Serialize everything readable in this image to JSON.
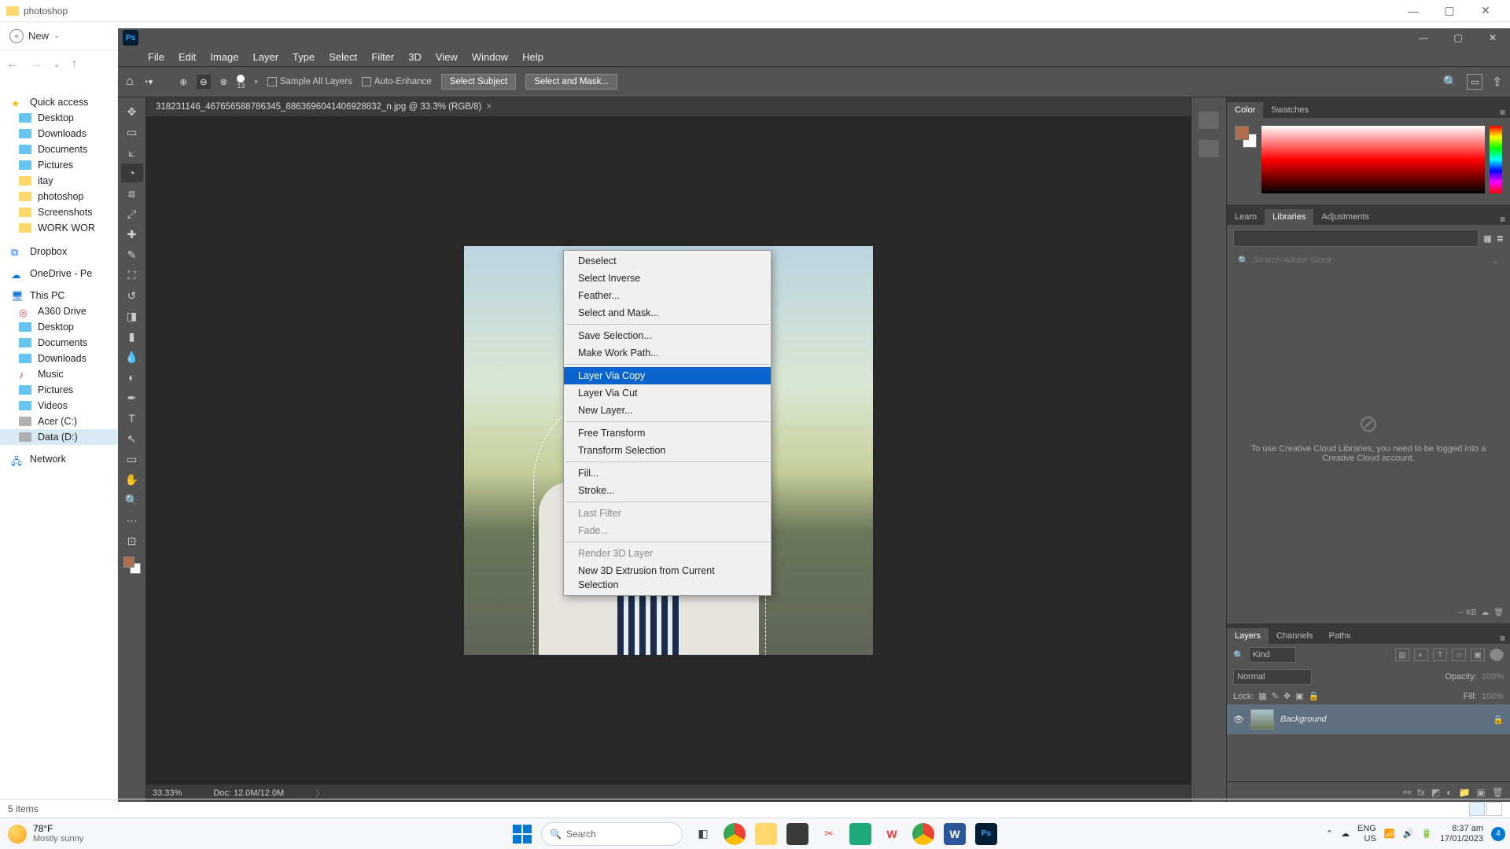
{
  "explorer": {
    "title": "photoshop",
    "new_label": "New",
    "sidebar": {
      "quick_access": "Quick access",
      "items": [
        "Desktop",
        "Downloads",
        "Documents",
        "Pictures",
        "itay",
        "photoshop",
        "Screenshots",
        "WORK WOR"
      ],
      "dropbox": "Dropbox",
      "onedrive": "OneDrive - Pe",
      "thispc": "This PC",
      "pc_items": [
        "A360 Drive",
        "Desktop",
        "Documents",
        "Downloads",
        "Music",
        "Pictures",
        "Videos",
        "Acer (C:)",
        "Data (D:)"
      ],
      "network": "Network"
    },
    "status": "5 items"
  },
  "ps": {
    "menu": [
      "File",
      "Edit",
      "Image",
      "Layer",
      "Type",
      "Select",
      "Filter",
      "3D",
      "View",
      "Window",
      "Help"
    ],
    "opts": {
      "brush_size": "13",
      "sample_all": "Sample All Layers",
      "auto_enhance": "Auto-Enhance",
      "select_subject": "Select Subject",
      "select_mask": "Select and Mask..."
    },
    "doc_tab": "318231146_467656588786345_8863696041406928832_n.jpg @ 33.3% (RGB/8)",
    "zoom": "33.33%",
    "doc_info": "Doc: 12.0M/12.0M",
    "context": [
      {
        "t": "Deselect"
      },
      {
        "t": "Select Inverse"
      },
      {
        "t": "Feather..."
      },
      {
        "t": "Select and Mask..."
      },
      {
        "sep": true
      },
      {
        "t": "Save Selection..."
      },
      {
        "t": "Make Work Path..."
      },
      {
        "sep": true
      },
      {
        "t": "Layer Via Copy",
        "hl": true
      },
      {
        "t": "Layer Via Cut"
      },
      {
        "t": "New Layer..."
      },
      {
        "sep": true
      },
      {
        "t": "Free Transform"
      },
      {
        "t": "Transform Selection"
      },
      {
        "sep": true
      },
      {
        "t": "Fill..."
      },
      {
        "t": "Stroke..."
      },
      {
        "sep": true
      },
      {
        "t": "Last Filter",
        "dis": true
      },
      {
        "t": "Fade...",
        "dis": true
      },
      {
        "sep": true
      },
      {
        "t": "Render 3D Layer",
        "dis": true
      },
      {
        "t": "New 3D Extrusion from Current Selection"
      }
    ],
    "panels": {
      "color_tabs": [
        "Color",
        "Swatches"
      ],
      "mid_tabs": [
        "Learn",
        "Libraries",
        "Adjustments"
      ],
      "lib_search": "Search Adobe Stock",
      "lib_msg": "To use Creative Cloud Libraries, you need to be logged into a Creative Cloud account.",
      "lib_kb": "-- KB",
      "layer_tabs": [
        "Layers",
        "Channels",
        "Paths"
      ],
      "kind": "Kind",
      "blend": "Normal",
      "opacity_lbl": "Opacity:",
      "opacity_val": "100%",
      "lock_lbl": "Lock:",
      "fill_lbl": "Fill:",
      "fill_val": "100%",
      "layer_name": "Background"
    }
  },
  "taskbar": {
    "temp": "78°F",
    "cond": "Mostly sunny",
    "search": "Search",
    "lang1": "ENG",
    "lang2": "US",
    "time": "8:37 am",
    "date": "17/01/2023",
    "notif": "4"
  }
}
